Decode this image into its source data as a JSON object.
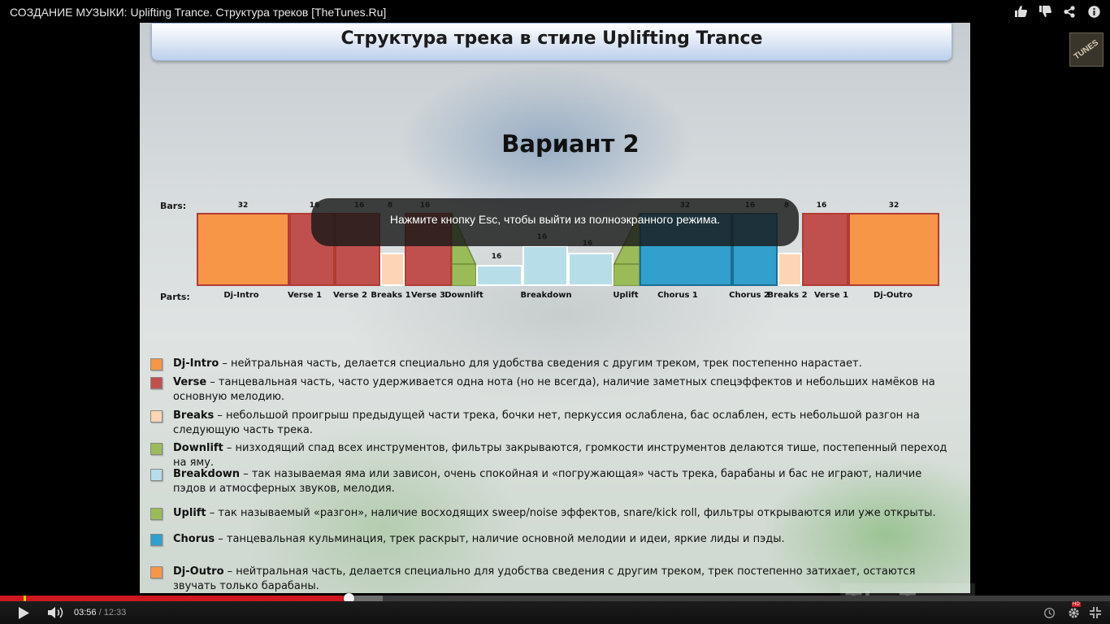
{
  "video": {
    "title": "СОЗДАНИЕ МУЗЫКИ: Uplifting Trance. Структура треков [TheTunes.Ru]",
    "channel_logo_text": "TUNES",
    "watermark_text": "TheTunes.Ru"
  },
  "top_actions": [
    {
      "name": "like-icon"
    },
    {
      "name": "dislike-icon"
    },
    {
      "name": "share-icon"
    },
    {
      "name": "info-icon"
    }
  ],
  "slide": {
    "header": "Структура трека в стиле Uplifting Trance",
    "variant": "Вариант 2",
    "bars_label": "Bars:",
    "parts_label": "Parts:",
    "sections": [
      {
        "part": "Dj-Intro",
        "bars": "32",
        "color": "#f79646"
      },
      {
        "part": "Verse 1",
        "bars": "16",
        "color": "#c0504d"
      },
      {
        "part": "Verse 2",
        "bars": "16",
        "color": "#c0504d"
      },
      {
        "part": "Breaks 1",
        "bars": "8",
        "color": "#fcd5b4"
      },
      {
        "part": "Verse 3",
        "bars": "16",
        "color": "#c0504d"
      },
      {
        "part": "Downlift",
        "bars": "",
        "color": "#9bbb59"
      },
      {
        "part": "",
        "bars": "16",
        "color": "#b7dee8"
      },
      {
        "part": "Breakdown",
        "bars": "16",
        "color": "#b7dee8"
      },
      {
        "part": "",
        "bars": "16",
        "color": "#b7dee8"
      },
      {
        "part": "Uplift",
        "bars": "",
        "color": "#9bbb59"
      },
      {
        "part": "Chorus 1",
        "bars": "32",
        "color": "#31a0cd"
      },
      {
        "part": "Chorus 2",
        "bars": "16",
        "color": "#31a0cd"
      },
      {
        "part": "Breaks 2",
        "bars": "8",
        "color": "#fcd5b4"
      },
      {
        "part": "Verse 1",
        "bars": "16",
        "color": "#c0504d"
      },
      {
        "part": "Dj-Outro",
        "bars": "32",
        "color": "#f79646"
      }
    ],
    "legend": [
      {
        "term": "Dj-Intro",
        "text": " – нейтральная часть, делается специально для удобства сведения с другим треком, трек постепенно нарастает.",
        "color": "#f79646"
      },
      {
        "term": "Verse",
        "text": " – танцевальная часть, часто удерживается одна нота (но не всегда), наличие заметных спецэффектов и небольших намёков на основную мелодию.",
        "color": "#c0504d"
      },
      {
        "term": "Breaks",
        "text": " – небольшой проигрыш предыдущей части трека, бочки нет, перкуссия ослаблена, бас ослаблен, есть небольшой разгон на следующую часть трека.",
        "color": "#fcd5b4"
      },
      {
        "term": "Downlift",
        "text": " – низходящий спад всех инструментов, фильтры закрываются, громкости инструментов делаются тише, постепенный переход на яму.",
        "color": "#9bbb59"
      },
      {
        "term": "Breakdown",
        "text": " – так называемая яма или зависон, очень спокойная и «погружающая» часть трека, барабаны и бас не играют, наличие пэдов и атмосферных звуков, мелодия.",
        "color": "#b7dee8"
      },
      {
        "term": "Uplift",
        "text": " – так называемый «разгон», наличие восходящих sweep/noise эффектов, snare/kick roll, фильтры открываются или уже открыты.",
        "color": "#9bbb59"
      },
      {
        "term": "Chorus",
        "text": " – танцевальная кульминация, трек раскрыт, наличие основной мелодии и идеи, яркие лиды и пэды.",
        "color": "#31a0cd"
      },
      {
        "term": "Dj-Outro",
        "text": " – нейтральная часть, делается специально для удобства сведения с другим треком, трек постепенно затихает, остаются звучать только барабаны.",
        "color": "#f79646"
      }
    ]
  },
  "fullscreen_toast": "Нажмите кнопку Esc, чтобы выйти из полноэкранного режима.",
  "player": {
    "current_time": "03:56",
    "separator": " / ",
    "duration": "12:33",
    "played_fraction": 0.314,
    "buffered_fraction": 0.345,
    "marker_fraction": 0.0215,
    "hd_badge": "HD",
    "buttons": [
      {
        "name": "play-icon"
      },
      {
        "name": "volume-icon"
      },
      {
        "name": "watch-later-icon"
      },
      {
        "name": "settings-icon"
      },
      {
        "name": "fullscreen-exit-icon"
      }
    ]
  }
}
